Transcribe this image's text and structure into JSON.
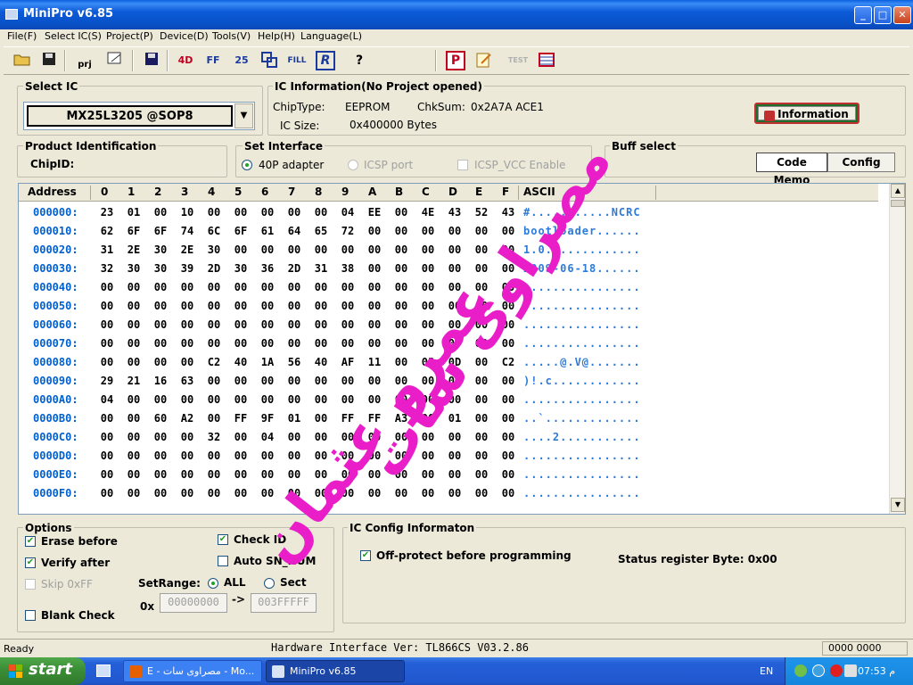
{
  "window": {
    "title": "MiniPro v6.85"
  },
  "menu": [
    "File(F)",
    "Select IC(S)",
    "Project(P)",
    "Device(D)",
    "Tools(V)",
    "Help(H)",
    "Language(L)"
  ],
  "toolbar": {
    "prj_label": "prj",
    "fill_label": "FILL",
    "test_label": "TEST",
    "help_label": "?",
    "btn_4d": "4D",
    "btn_25": "25",
    "btn_r": "R",
    "btn_p": "P",
    "btn_ff": "FF"
  },
  "select_ic": {
    "label": "Select IC",
    "value": "MX25L3205  @SOP8"
  },
  "ic_info": {
    "label": "IC Information(No Project opened)",
    "chip_type_label": "ChipType:",
    "chip_type": "EEPROM",
    "chksum_label": "ChkSum:",
    "chksum": "0x2A7A ACE1",
    "ic_size_label": "IC Size:",
    "ic_size": "0x400000 Bytes",
    "info_button": "Information"
  },
  "product_id": {
    "label": "Product Identification",
    "chip_id_label": "ChipID:"
  },
  "set_interface": {
    "label": "Set Interface",
    "opt1": "40P adapter",
    "opt2": "ICSP port",
    "opt3": "ICSP_VCC Enable"
  },
  "buff_select": {
    "label": "Buff select",
    "code_memo": "Code Memo",
    "config": "Config"
  },
  "hex": {
    "address_header": "Address",
    "columns": [
      "0",
      "1",
      "2",
      "3",
      "4",
      "5",
      "6",
      "7",
      "8",
      "9",
      "A",
      "B",
      "C",
      "D",
      "E",
      "F"
    ],
    "ascii_header": "ASCII",
    "rows": [
      {
        "addr": "000000:",
        "bytes": [
          "23",
          "01",
          "00",
          "10",
          "00",
          "00",
          "00",
          "00",
          "00",
          "04",
          "EE",
          "00",
          "4E",
          "43",
          "52",
          "43"
        ],
        "ascii": "#...........NCRC"
      },
      {
        "addr": "000010:",
        "bytes": [
          "62",
          "6F",
          "6F",
          "74",
          "6C",
          "6F",
          "61",
          "64",
          "65",
          "72",
          "00",
          "00",
          "00",
          "00",
          "00",
          "00"
        ],
        "ascii": "bootloader......"
      },
      {
        "addr": "000020:",
        "bytes": [
          "31",
          "2E",
          "30",
          "2E",
          "30",
          "00",
          "00",
          "00",
          "00",
          "00",
          "00",
          "00",
          "00",
          "00",
          "00",
          "00"
        ],
        "ascii": "1.0.0..........."
      },
      {
        "addr": "000030:",
        "bytes": [
          "32",
          "30",
          "30",
          "39",
          "2D",
          "30",
          "36",
          "2D",
          "31",
          "38",
          "00",
          "00",
          "00",
          "00",
          "00",
          "00"
        ],
        "ascii": "2009-06-18......"
      },
      {
        "addr": "000040:",
        "bytes": [
          "00",
          "00",
          "00",
          "00",
          "00",
          "00",
          "00",
          "00",
          "00",
          "00",
          "00",
          "00",
          "00",
          "00",
          "00",
          "00"
        ],
        "ascii": "................"
      },
      {
        "addr": "000050:",
        "bytes": [
          "00",
          "00",
          "00",
          "00",
          "00",
          "00",
          "00",
          "00",
          "00",
          "00",
          "00",
          "00",
          "00",
          "00",
          "00",
          "00"
        ],
        "ascii": "................"
      },
      {
        "addr": "000060:",
        "bytes": [
          "00",
          "00",
          "00",
          "00",
          "00",
          "00",
          "00",
          "00",
          "00",
          "00",
          "00",
          "00",
          "00",
          "00",
          "00",
          "00"
        ],
        "ascii": "................"
      },
      {
        "addr": "000070:",
        "bytes": [
          "00",
          "00",
          "00",
          "00",
          "00",
          "00",
          "00",
          "00",
          "00",
          "00",
          "00",
          "00",
          "00",
          "00",
          "00",
          "00"
        ],
        "ascii": "................"
      },
      {
        "addr": "000080:",
        "bytes": [
          "00",
          "00",
          "00",
          "00",
          "C2",
          "40",
          "1A",
          "56",
          "40",
          "AF",
          "11",
          "00",
          "03",
          "0D",
          "00",
          "C2"
        ],
        "ascii": ".....@.V@......."
      },
      {
        "addr": "000090:",
        "bytes": [
          "29",
          "21",
          "16",
          "63",
          "00",
          "00",
          "00",
          "00",
          "00",
          "00",
          "00",
          "00",
          "00",
          "00",
          "00",
          "00"
        ],
        "ascii": ")!.c............"
      },
      {
        "addr": "0000A0:",
        "bytes": [
          "04",
          "00",
          "00",
          "00",
          "00",
          "00",
          "00",
          "00",
          "00",
          "00",
          "00",
          "00",
          "00",
          "00",
          "00",
          "00"
        ],
        "ascii": "................"
      },
      {
        "addr": "0000B0:",
        "bytes": [
          "00",
          "00",
          "60",
          "A2",
          "00",
          "FF",
          "9F",
          "01",
          "00",
          "FF",
          "FF",
          "A3",
          "00",
          "01",
          "00",
          "00"
        ],
        "ascii": "..`............."
      },
      {
        "addr": "0000C0:",
        "bytes": [
          "00",
          "00",
          "00",
          "00",
          "32",
          "00",
          "04",
          "00",
          "00",
          "00",
          "00",
          "00",
          "00",
          "00",
          "00",
          "00"
        ],
        "ascii": "....2..........."
      },
      {
        "addr": "0000D0:",
        "bytes": [
          "00",
          "00",
          "00",
          "00",
          "00",
          "00",
          "00",
          "00",
          "00",
          "00",
          "00",
          "00",
          "00",
          "00",
          "00",
          "00"
        ],
        "ascii": "................"
      },
      {
        "addr": "0000E0:",
        "bytes": [
          "00",
          "00",
          "00",
          "00",
          "00",
          "00",
          "00",
          "00",
          "00",
          "00",
          "00",
          "00",
          "00",
          "00",
          "00",
          "00"
        ],
        "ascii": "................"
      },
      {
        "addr": "0000F0:",
        "bytes": [
          "00",
          "00",
          "00",
          "00",
          "00",
          "00",
          "00",
          "00",
          "00",
          "00",
          "00",
          "00",
          "00",
          "00",
          "00",
          "00"
        ],
        "ascii": "................"
      }
    ]
  },
  "options": {
    "label": "Options",
    "erase_before": "Erase before",
    "verify_after": "Verify after",
    "skip_0xff": "Skip 0xFF",
    "blank_check": "Blank Check",
    "check_id": "Check ID",
    "auto_sn": "Auto SN_NUM",
    "set_range_label": "SetRange:",
    "range_all": "ALL",
    "range_sect": "Sect",
    "hex_prefix": "0x",
    "range_start": "00000000",
    "range_arrow": "->",
    "range_end": "003FFFFF"
  },
  "ic_config": {
    "label": "IC Config Informaton",
    "off_protect": "Off-protect before programming",
    "status_register": "Status register Byte: 0x00"
  },
  "status": {
    "ready": "Ready",
    "hardware": "Hardware Interface Ver: TL866CS V03.2.86",
    "code": "0000 0000"
  },
  "taskbar": {
    "start": "start",
    "task1": "E - مصراوى سات - Mo...",
    "task2": "MiniPro v6.85",
    "lang": "EN",
    "clock": "07:53 م"
  },
  "watermark": {
    "line1": "مصراوى سات",
    "line2": "عمرو عثمان"
  },
  "colors": {
    "titlebar": "#0a5fe0",
    "address": "#0060d0",
    "ascii": "#2d7bd8",
    "watermark": "#e91ec8",
    "check": "#21a121"
  }
}
